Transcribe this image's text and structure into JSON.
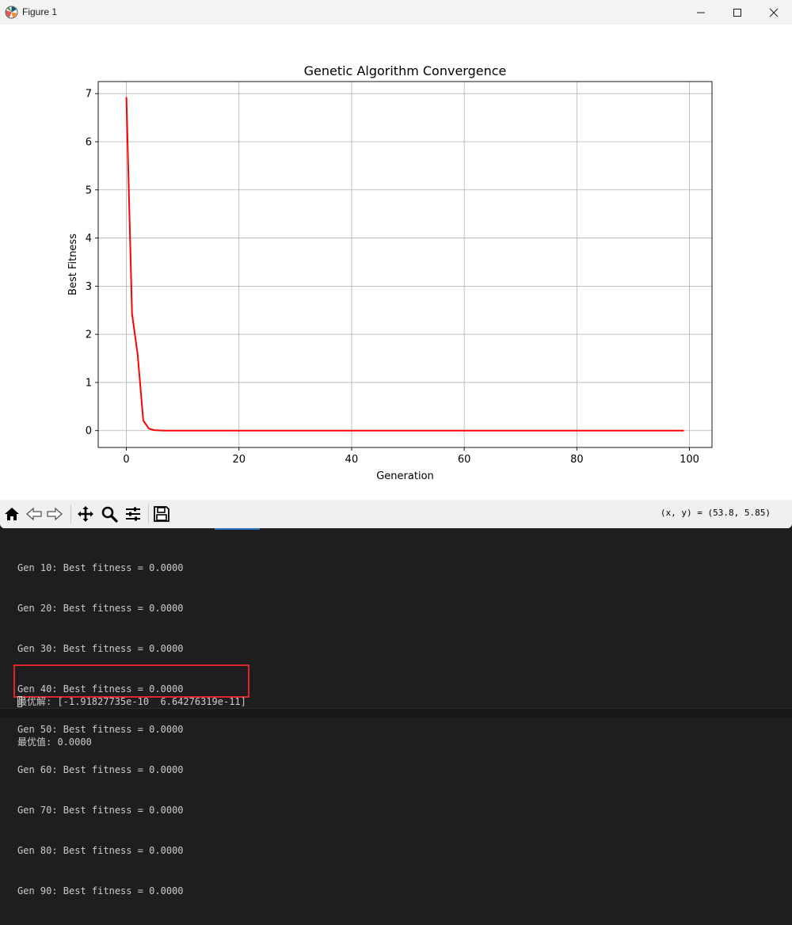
{
  "window": {
    "title": "Figure 1",
    "icon": "matplotlib-icon",
    "controls": [
      "minimize-icon",
      "maximize-icon",
      "close-icon"
    ]
  },
  "toolbar": {
    "buttons": [
      "home-icon",
      "back-arrow-icon",
      "forward-arrow-icon",
      "pan-icon",
      "zoom-icon",
      "configure-subplots-icon",
      "save-icon"
    ],
    "coordinates": "(x, y) = (53.8, 5.85)"
  },
  "chart_data": {
    "type": "line",
    "title": "Genetic Algorithm Convergence",
    "xlabel": "Generation",
    "ylabel": "Best Fitness",
    "xlim": [
      -5,
      104
    ],
    "ylim": [
      -0.35,
      7.25
    ],
    "xticks": [
      0,
      20,
      40,
      60,
      80,
      100
    ],
    "yticks": [
      0,
      1,
      2,
      3,
      4,
      5,
      6,
      7
    ],
    "grid": true,
    "line_color": "#ff0000",
    "series": [
      {
        "x": [
          0,
          1,
          2,
          3,
          4,
          5,
          6,
          7,
          8,
          9,
          10,
          20,
          30,
          40,
          50,
          60,
          70,
          80,
          90,
          99
        ],
        "values": [
          6.93,
          2.43,
          1.58,
          0.21,
          0.04,
          0.01,
          0.003,
          0.001,
          0.0,
          0.0,
          0.0,
          0.0,
          0.0,
          0.0,
          0.0,
          0.0,
          0.0,
          0.0,
          0.0,
          0.0
        ]
      }
    ]
  },
  "terminal": {
    "lines": [
      "Gen 10: Best fitness = 0.0000",
      "Gen 20: Best fitness = 0.0000",
      "Gen 30: Best fitness = 0.0000",
      "Gen 40: Best fitness = 0.0000",
      "Gen 50: Best fitness = 0.0000",
      "Gen 60: Best fitness = 0.0000",
      "Gen 70: Best fitness = 0.0000",
      "Gen 80: Best fitness = 0.0000",
      "Gen 90: Best fitness = 0.0000"
    ],
    "result": {
      "solution": "最优解: [-1.91827735e-10  6.64276319e-11]",
      "value": "最优值: 0.0000"
    },
    "highlight_color": "#e0242c"
  }
}
